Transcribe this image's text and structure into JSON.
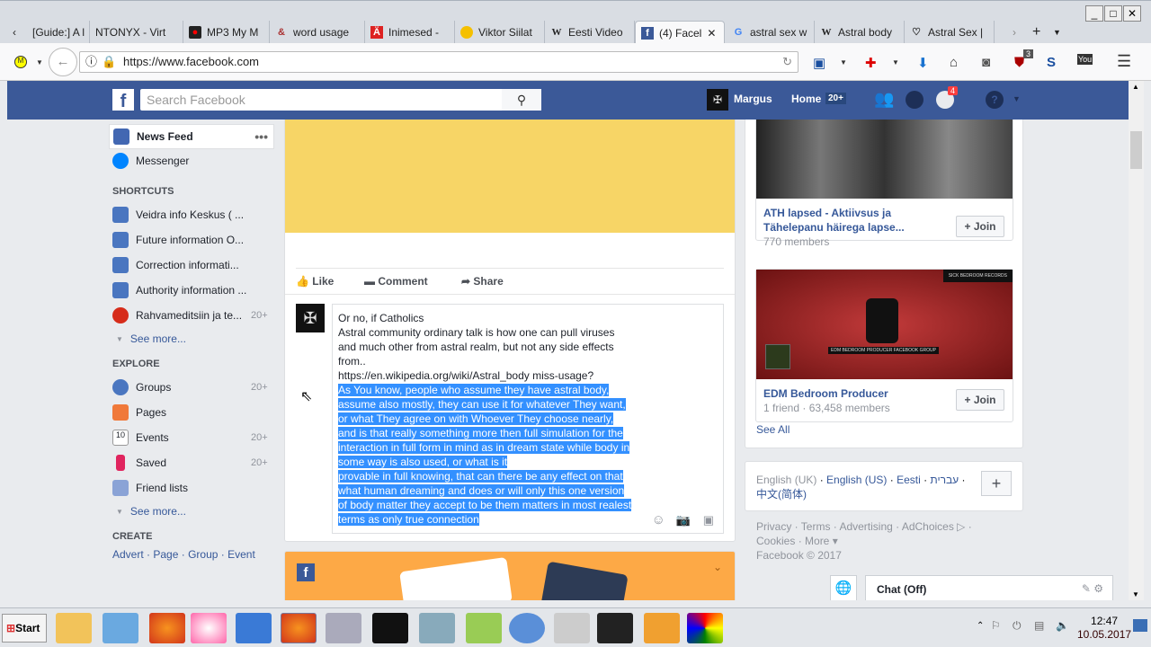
{
  "browser": {
    "tabs": [
      {
        "label": "[Guide:] A l"
      },
      {
        "label": "NTONYX - Virt"
      },
      {
        "label": "MP3 My M"
      },
      {
        "label": "word usage"
      },
      {
        "label": "Inimesed -"
      },
      {
        "label": "Viktor Siilat"
      },
      {
        "label": "Eesti Video"
      },
      {
        "label": "(4) Facel"
      },
      {
        "label": "astral sex w"
      },
      {
        "label": "Astral body"
      },
      {
        "label": "Astral Sex |"
      }
    ],
    "url": "https://www.facebook.com",
    "ext_badge": "3"
  },
  "fb": {
    "search_placeholder": "Search Facebook",
    "user": "Margus",
    "home": "Home",
    "home_count": "20+",
    "notif_count": "4"
  },
  "sidebar": {
    "news_feed": "News Feed",
    "messenger": "Messenger",
    "shortcuts_title": "SHORTCUTS",
    "shortcuts": [
      {
        "label": "Veidra info Keskus ( ..."
      },
      {
        "label": "Future information O..."
      },
      {
        "label": "Correction informati..."
      },
      {
        "label": "Authority information ..."
      },
      {
        "label": "Rahvameditsiin ja te...",
        "count": "20+"
      }
    ],
    "see_more": "See more...",
    "explore_title": "EXPLORE",
    "explore": [
      {
        "label": "Groups",
        "count": "20+"
      },
      {
        "label": "Pages"
      },
      {
        "label": "Events",
        "count": "20+"
      },
      {
        "label": "Saved",
        "count": "20+"
      },
      {
        "label": "Friend lists"
      }
    ],
    "see_more2": "See more...",
    "create_title": "CREATE",
    "create_links": [
      "Advert",
      "Page",
      "Group",
      "Event"
    ]
  },
  "post": {
    "like": "Like",
    "comment": "Comment",
    "share": "Share",
    "comment_lines": [
      "Or no, if Catholics",
      "Astral community ordinary talk is how one can pull viruses",
      "and much other from astral realm, but not any  side effects",
      "from..",
      "https://en.wikipedia.org/wiki/Astral_body miss-usage?"
    ],
    "selected_lines": [
      "As You know, people who assume they have astral body,",
      "assume also mostly, they can use it for whatever They want,",
      "or what They agree on with Whoever They choose nearly,",
      "and is that really something more then full simulation for the",
      "interaction in full form in mind as in dream state while body in",
      "some way is also used, or what is it",
      "provable in full knowing, that can there be any effect on that",
      "what human dreaming and does or will only this one version",
      "of body matter they accept to be them matters in most realest",
      "terms as only true connection"
    ]
  },
  "groups": [
    {
      "name1": "ATH lapsed - Aktiivsus ja",
      "name2": "Tähelepanu häirega lapse...",
      "meta": "770 members",
      "join": "+ Join"
    },
    {
      "name1": "EDM Bedroom Producer",
      "meta": "1 friend · 63,458 members",
      "join": "+ Join",
      "banner_text": "EDM BEDROOM PRODUCER FACEBOOK GROUP",
      "corner_text": "SICK BEDROOM RECORDS"
    }
  ],
  "see_all": "See All",
  "languages": {
    "current": "English (UK)",
    "links": [
      "English (US)",
      "Eesti",
      "עברית",
      "中文(简体)"
    ]
  },
  "footer": {
    "line1": "Privacy · Terms · Advertising · AdChoices ▷ ·",
    "line2": "Cookies · More ▾",
    "line3": "Facebook © 2017"
  },
  "chat": "Chat (Off)",
  "taskbar": {
    "start": "Start",
    "time": "12:47",
    "date": "10.05.2017"
  }
}
